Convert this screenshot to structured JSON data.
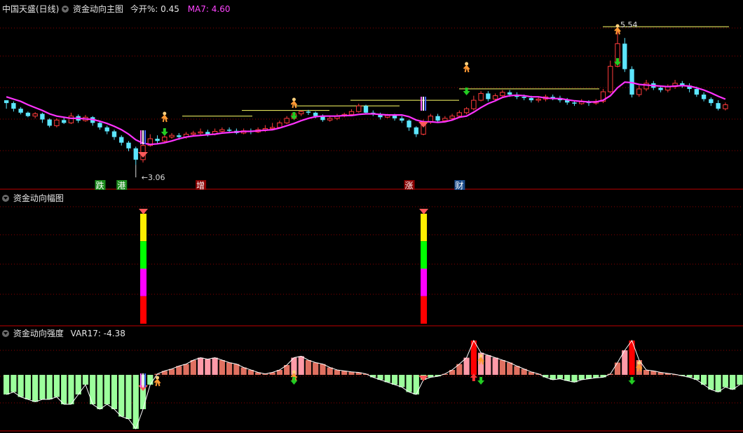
{
  "header_main": {
    "title": "中国天盛(日线)",
    "indicator": "资金动向主图",
    "today_open_label": "今开%: 0.45",
    "ma7_label": "MA7: 4.60"
  },
  "header_mid": {
    "indicator": "资金动向幅图"
  },
  "header_bottom": {
    "indicator": "资金动向强度",
    "var_label": "VAR17: -4.38"
  },
  "colors": {
    "background": "#000000",
    "grid": "#8b0000",
    "up": "#ff3b3b",
    "down": "#5ce6ff",
    "ma": "#ff33ff",
    "resistance_line": "#ffff66",
    "hist_pos": "#ff8080",
    "hist_pos_strong": "#ff0000",
    "hist_neg": "#9cff9c"
  },
  "icons": [
    "running-man-icon",
    "diamond-icon",
    "down-arrow-icon",
    "up-arrow-icon"
  ],
  "chart_data": [
    {
      "type": "candlestick",
      "title": "资金动向主图",
      "price_labels": {
        "low": "3.06",
        "high": "5.54"
      },
      "candles": [
        [
          4.2,
          4.15,
          4.2,
          4.05
        ],
        [
          4.15,
          4.05,
          4.18,
          4.0
        ],
        [
          4.05,
          3.98,
          4.08,
          3.95
        ],
        [
          3.98,
          3.92,
          4.0,
          3.9
        ],
        [
          3.92,
          3.96,
          3.99,
          3.88
        ],
        [
          3.96,
          3.86,
          3.98,
          3.8
        ],
        [
          3.86,
          3.75,
          3.88,
          3.72
        ],
        [
          3.75,
          3.85,
          3.88,
          3.72
        ],
        [
          3.85,
          3.8,
          3.9,
          3.78
        ],
        [
          3.8,
          3.92,
          3.98,
          3.78
        ],
        [
          3.92,
          3.84,
          3.95,
          3.8
        ],
        [
          3.84,
          3.9,
          3.94,
          3.82
        ],
        [
          3.9,
          3.8,
          3.92,
          3.75
        ],
        [
          3.8,
          3.72,
          3.82,
          3.68
        ],
        [
          3.72,
          3.65,
          3.75,
          3.6
        ],
        [
          3.65,
          3.55,
          3.68,
          3.5
        ],
        [
          3.55,
          3.45,
          3.58,
          3.4
        ],
        [
          3.45,
          3.35,
          3.48,
          3.3
        ],
        [
          3.35,
          3.15,
          3.38,
          3.06
        ],
        [
          3.15,
          3.4,
          3.45,
          3.1
        ],
        [
          3.4,
          3.52,
          3.6,
          3.38
        ],
        [
          3.52,
          3.48,
          3.58,
          3.44
        ],
        [
          3.48,
          3.55,
          3.6,
          3.45
        ],
        [
          3.55,
          3.58,
          3.62,
          3.52
        ],
        [
          3.58,
          3.55,
          3.62,
          3.5
        ],
        [
          3.55,
          3.6,
          3.64,
          3.52
        ],
        [
          3.6,
          3.62,
          3.66,
          3.56
        ],
        [
          3.62,
          3.64,
          3.7,
          3.58
        ],
        [
          3.64,
          3.6,
          3.68,
          3.56
        ],
        [
          3.6,
          3.65,
          3.7,
          3.58
        ],
        [
          3.65,
          3.68,
          3.72,
          3.62
        ],
        [
          3.68,
          3.66,
          3.72,
          3.62
        ],
        [
          3.66,
          3.62,
          3.7,
          3.6
        ],
        [
          3.62,
          3.66,
          3.7,
          3.6
        ],
        [
          3.66,
          3.64,
          3.7,
          3.6
        ],
        [
          3.64,
          3.68,
          3.72,
          3.62
        ],
        [
          3.68,
          3.7,
          3.76,
          3.64
        ],
        [
          3.7,
          3.72,
          3.8,
          3.68
        ],
        [
          3.72,
          3.8,
          3.84,
          3.7
        ],
        [
          3.8,
          3.88,
          3.92,
          3.78
        ],
        [
          3.88,
          3.96,
          3.98,
          3.85
        ],
        [
          3.96,
          4.0,
          4.02,
          3.92
        ],
        [
          4.0,
          3.98,
          4.03,
          3.94
        ],
        [
          3.98,
          3.92,
          4.0,
          3.88
        ],
        [
          3.92,
          3.85,
          3.95,
          3.82
        ],
        [
          3.85,
          3.88,
          3.92,
          3.82
        ],
        [
          3.88,
          3.92,
          3.96,
          3.85
        ],
        [
          3.92,
          3.95,
          3.98,
          3.9
        ],
        [
          3.95,
          4.0,
          4.04,
          3.92
        ],
        [
          4.0,
          4.1,
          4.14,
          3.98
        ],
        [
          4.1,
          3.98,
          4.12,
          3.95
        ],
        [
          3.98,
          3.95,
          4.02,
          3.92
        ],
        [
          3.95,
          3.9,
          3.98,
          3.86
        ],
        [
          3.9,
          3.93,
          3.96,
          3.88
        ],
        [
          3.93,
          3.88,
          3.96,
          3.84
        ],
        [
          3.88,
          3.84,
          3.92,
          3.8
        ],
        [
          3.84,
          3.72,
          3.86,
          3.66
        ],
        [
          3.72,
          3.6,
          3.74,
          3.55
        ],
        [
          3.6,
          3.82,
          3.86,
          3.58
        ],
        [
          3.82,
          3.92,
          3.96,
          3.78
        ],
        [
          3.92,
          3.84,
          3.96,
          3.8
        ],
        [
          3.84,
          3.88,
          3.92,
          3.82
        ],
        [
          3.88,
          3.92,
          3.96,
          3.85
        ],
        [
          3.92,
          3.98,
          4.02,
          3.9
        ],
        [
          3.98,
          4.05,
          4.08,
          3.95
        ],
        [
          4.05,
          4.2,
          4.28,
          4.02
        ],
        [
          4.2,
          4.32,
          4.36,
          4.18
        ],
        [
          4.32,
          4.22,
          4.36,
          4.18
        ],
        [
          4.22,
          4.28,
          4.32,
          4.2
        ],
        [
          4.28,
          4.34,
          4.38,
          4.26
        ],
        [
          4.34,
          4.3,
          4.38,
          4.26
        ],
        [
          4.3,
          4.26,
          4.34,
          4.22
        ],
        [
          4.26,
          4.24,
          4.3,
          4.2
        ],
        [
          4.24,
          4.2,
          4.28,
          4.16
        ],
        [
          4.2,
          4.22,
          4.26,
          4.16
        ],
        [
          4.22,
          4.26,
          4.3,
          4.18
        ],
        [
          4.26,
          4.24,
          4.3,
          4.2
        ],
        [
          4.24,
          4.2,
          4.28,
          4.16
        ],
        [
          4.2,
          4.16,
          4.24,
          4.12
        ],
        [
          4.16,
          4.14,
          4.2,
          4.1
        ],
        [
          4.14,
          4.17,
          4.22,
          4.12
        ],
        [
          4.17,
          4.15,
          4.2,
          4.1
        ],
        [
          4.15,
          4.18,
          4.22,
          4.12
        ],
        [
          4.18,
          4.35,
          4.4,
          4.15
        ],
        [
          4.35,
          4.8,
          4.9,
          4.32
        ],
        [
          4.8,
          5.2,
          5.54,
          4.78
        ],
        [
          5.2,
          4.75,
          5.3,
          4.7
        ],
        [
          4.75,
          4.3,
          4.8,
          4.25
        ],
        [
          4.3,
          4.4,
          4.46,
          4.26
        ],
        [
          4.4,
          4.5,
          4.56,
          4.36
        ],
        [
          4.5,
          4.42,
          4.54,
          4.38
        ],
        [
          4.42,
          4.38,
          4.46,
          4.34
        ],
        [
          4.38,
          4.44,
          4.48,
          4.34
        ],
        [
          4.44,
          4.5,
          4.56,
          4.4
        ],
        [
          4.5,
          4.46,
          4.54,
          4.42
        ],
        [
          4.46,
          4.4,
          4.5,
          4.34
        ],
        [
          4.4,
          4.3,
          4.44,
          4.26
        ],
        [
          4.3,
          4.22,
          4.34,
          4.18
        ],
        [
          4.22,
          4.15,
          4.25,
          4.1
        ],
        [
          4.15,
          4.05,
          4.2,
          4.02
        ],
        [
          4.05,
          4.12,
          4.16,
          4.02
        ]
      ],
      "ma7": [
        4.26,
        4.22,
        4.18,
        4.12,
        4.07,
        4.02,
        3.96,
        3.92,
        3.9,
        3.88,
        3.88,
        3.87,
        3.86,
        3.83,
        3.79,
        3.74,
        3.68,
        3.6,
        3.5,
        3.44,
        3.42,
        3.43,
        3.45,
        3.48,
        3.52,
        3.55,
        3.57,
        3.58,
        3.59,
        3.6,
        3.62,
        3.63,
        3.64,
        3.65,
        3.65,
        3.66,
        3.67,
        3.68,
        3.71,
        3.75,
        3.79,
        3.84,
        3.88,
        3.91,
        3.92,
        3.92,
        3.92,
        3.93,
        3.93,
        3.95,
        3.96,
        3.96,
        3.95,
        3.94,
        3.94,
        3.94,
        3.91,
        3.85,
        3.82,
        3.82,
        3.81,
        3.82,
        3.85,
        3.9,
        3.92,
        3.99,
        4.07,
        4.14,
        4.19,
        4.25,
        4.28,
        4.29,
        4.28,
        4.26,
        4.26,
        4.24,
        4.23,
        4.23,
        4.21,
        4.19,
        4.18,
        4.17,
        4.17,
        4.2,
        4.28,
        4.42,
        4.52,
        4.51,
        4.48,
        4.47,
        4.46,
        4.45,
        4.44,
        4.45,
        4.46,
        4.45,
        4.42,
        4.38,
        4.33,
        4.27,
        4.22
      ]
    },
    {
      "type": "bar",
      "title": "资金动向幅图",
      "signal_bars": [
        19,
        58
      ],
      "segment_colors": [
        "#ffee00",
        "#00ff00",
        "#ff00ff",
        "#ff0000"
      ]
    },
    {
      "type": "bar",
      "title": "资金动向强度",
      "var17": -4.38,
      "values": [
        -0.4,
        -0.35,
        -0.45,
        -0.5,
        -0.55,
        -0.5,
        -0.5,
        -0.45,
        -0.6,
        -0.6,
        -0.4,
        -0.2,
        -0.6,
        -0.7,
        -0.6,
        -0.7,
        -0.85,
        -0.9,
        -1.1,
        -0.7,
        -0.2,
        0.02,
        0.08,
        0.12,
        0.18,
        0.22,
        0.3,
        0.35,
        0.32,
        0.35,
        0.3,
        0.25,
        0.22,
        0.15,
        0.1,
        0.05,
        0.02,
        0.05,
        0.1,
        0.2,
        0.35,
        0.38,
        0.3,
        0.25,
        0.22,
        0.15,
        0.1,
        0.08,
        0.06,
        0.05,
        0.02,
        -0.05,
        -0.1,
        -0.15,
        -0.2,
        -0.25,
        -0.35,
        -0.4,
        -0.1,
        -0.05,
        -0.03,
        0.02,
        0.1,
        0.22,
        0.35,
        0.7,
        0.45,
        0.4,
        0.35,
        0.3,
        0.25,
        0.18,
        0.12,
        0.06,
        0.02,
        -0.05,
        -0.1,
        -0.08,
        -0.12,
        -0.15,
        -0.1,
        -0.08,
        -0.06,
        -0.05,
        0.02,
        0.25,
        0.5,
        0.7,
        0.3,
        0.1,
        0.08,
        0.05,
        0.03,
        0.01,
        -0.02,
        -0.05,
        -0.1,
        -0.2,
        -0.3,
        -0.35,
        -0.25,
        -0.3,
        -0.2
      ],
      "strong_bars": [
        65,
        87
      ]
    }
  ],
  "labels": {
    "low_price": "←3.06",
    "high_price": "5.54",
    "markers": [
      "跌",
      "港",
      "增",
      "涨",
      "财"
    ]
  }
}
